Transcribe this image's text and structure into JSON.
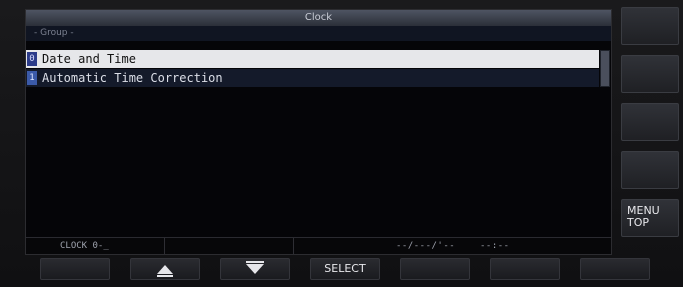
{
  "screen": {
    "title": "Clock",
    "group_label": "- Group -",
    "menu_items": [
      {
        "index": "0",
        "label": "Date and Time",
        "selected": true
      },
      {
        "index": "1",
        "label": "Automatic Time Correction",
        "selected": false
      }
    ],
    "status": {
      "menu_code": "CLOCK 0-_",
      "date": "--/---/'--",
      "time": "--:--"
    }
  },
  "side_keys": [
    "",
    "",
    "",
    "",
    "MENU\nTOP"
  ],
  "function_keys": [
    {
      "label": "",
      "icon": ""
    },
    {
      "label": "",
      "icon": "up-triangle-icon"
    },
    {
      "label": "",
      "icon": "down-triangle-icon"
    },
    {
      "label": "SELECT",
      "icon": ""
    },
    {
      "label": "",
      "icon": ""
    },
    {
      "label": "",
      "icon": ""
    },
    {
      "label": "",
      "icon": ""
    }
  ],
  "colors": {
    "selected_row": "#e6e7ea",
    "normal_row": "#141a2a",
    "index_badge": "#3b5aa8",
    "title_bar": "#4e5462"
  }
}
